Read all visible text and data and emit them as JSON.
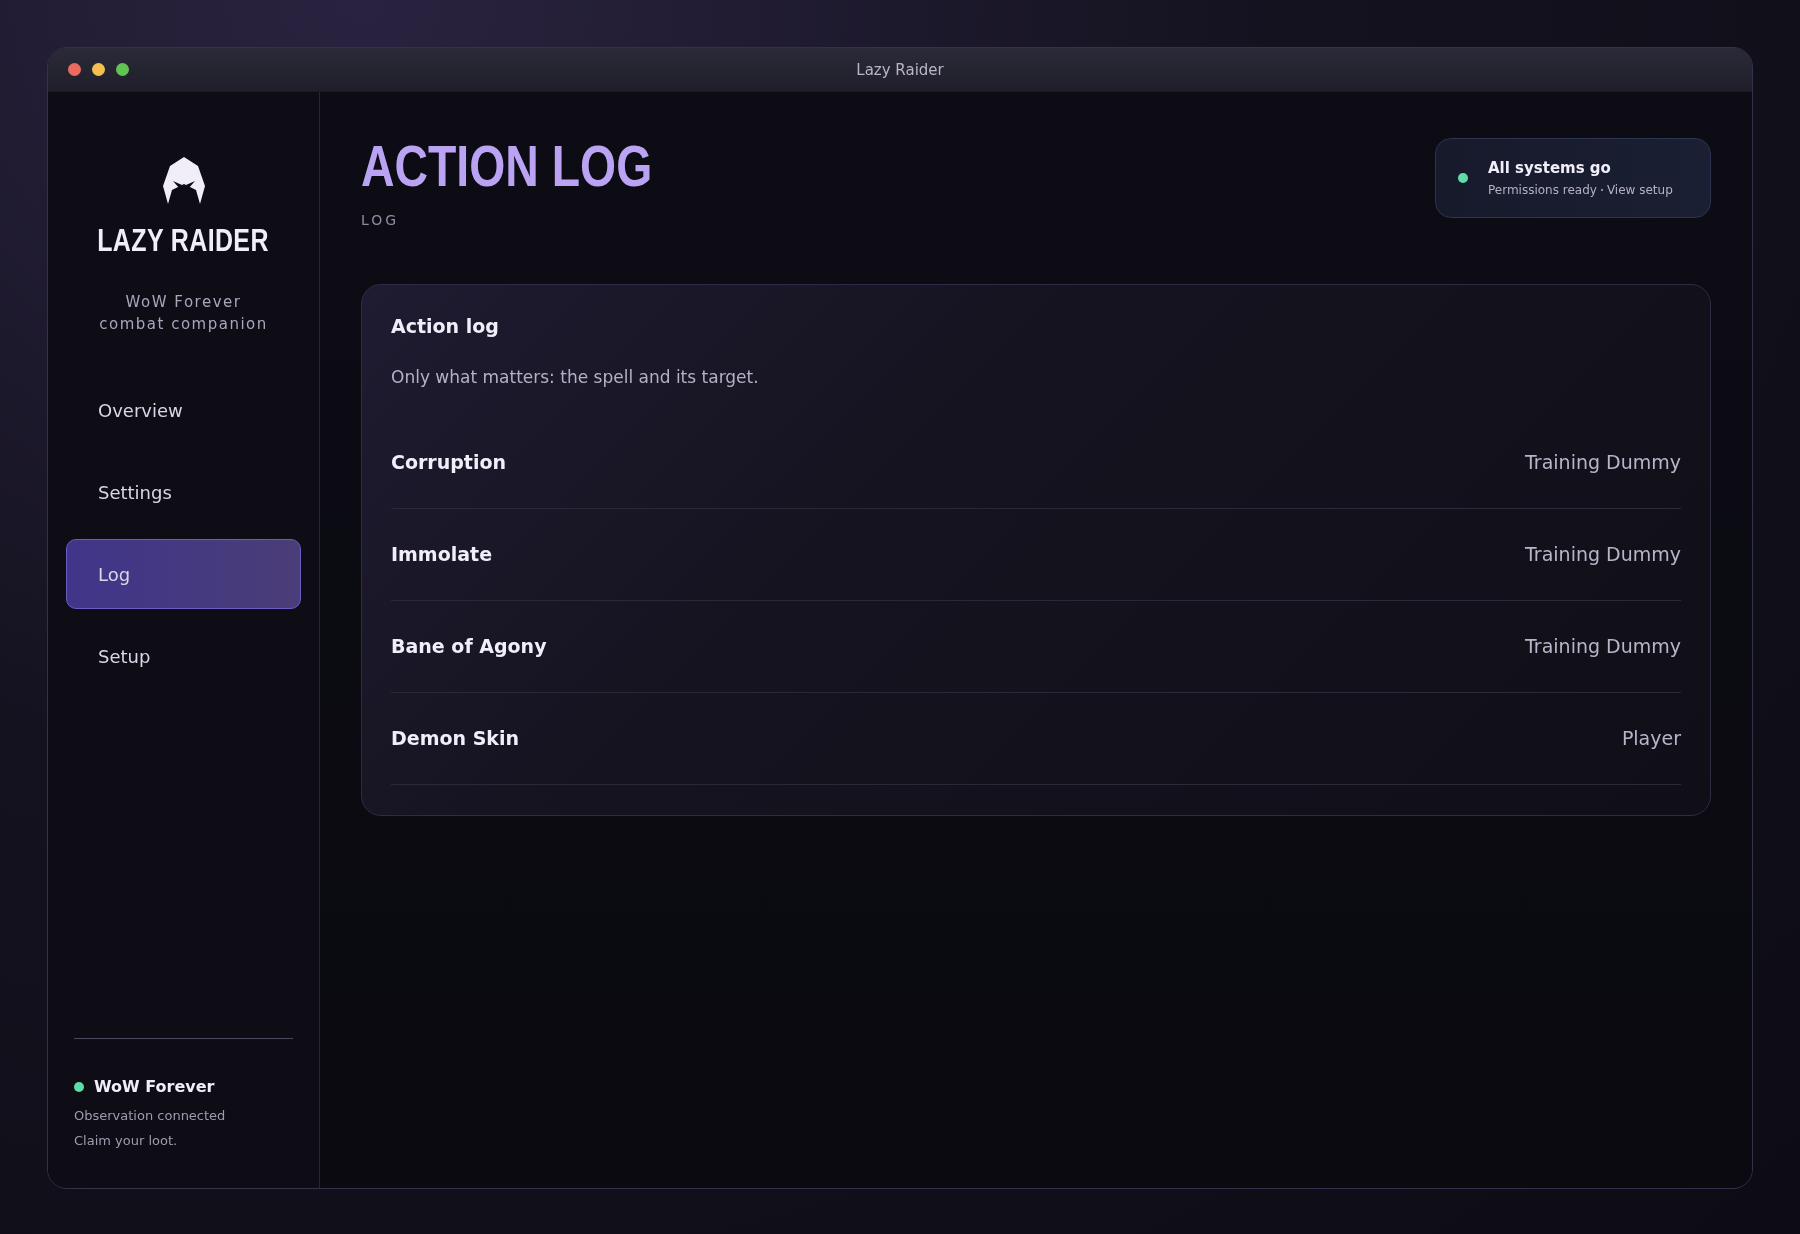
{
  "window": {
    "title": "Lazy Raider"
  },
  "brand": {
    "name": "LAZY RAIDER",
    "tagline_lines": [
      "WoW Forever",
      "combat companion"
    ]
  },
  "sidebar": {
    "items": [
      {
        "label": "Overview",
        "selected": false
      },
      {
        "label": "Settings",
        "selected": false
      },
      {
        "label": "Log",
        "selected": true
      },
      {
        "label": "Setup",
        "selected": false
      }
    ]
  },
  "connection": {
    "name": "WoW Forever",
    "color": "#5fdcaa",
    "status": "Observation connected",
    "note": "Claim your loot."
  },
  "header": {
    "title": "ACTION LOG",
    "subtitle": "LOG"
  },
  "status_card": {
    "title": "All systems go",
    "color": "#5fdcaa",
    "detail": "Permissions ready",
    "link": "View setup"
  },
  "log_card": {
    "title": "Action log",
    "description": "Only what matters: the spell and its target.",
    "rows": [
      {
        "spell": "Corruption",
        "target": "Training Dummy"
      },
      {
        "spell": "Immolate",
        "target": "Training Dummy"
      },
      {
        "spell": "Bane of Agony",
        "target": "Training Dummy"
      },
      {
        "spell": "Demon Skin",
        "target": "Player"
      }
    ]
  }
}
